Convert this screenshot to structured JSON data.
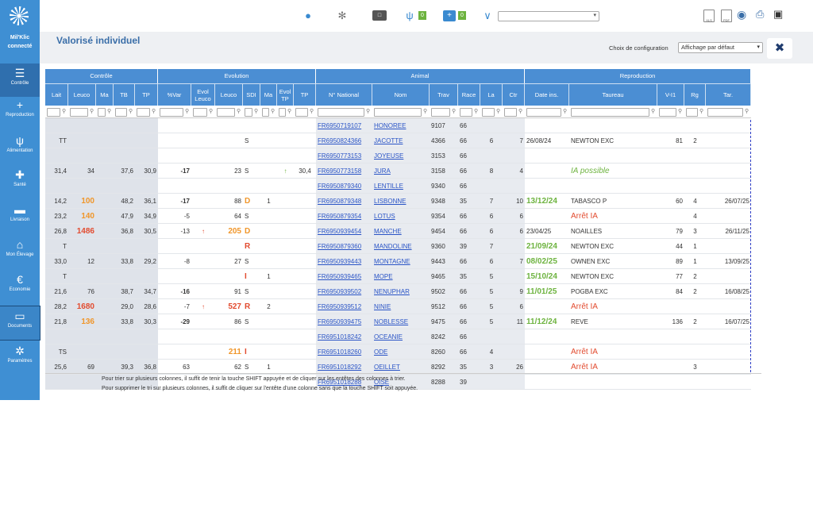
{
  "app": {
    "title": "Valorisé individuel",
    "brand_line1": "Mil'Klic",
    "brand_line2": "connecté"
  },
  "sidebar": {
    "items": [
      {
        "label": "Contrôle",
        "icon": "sliders-icon"
      },
      {
        "label": "Reproduction",
        "icon": "cow-plus-icon"
      },
      {
        "label": "Alimentation",
        "icon": "grass-icon"
      },
      {
        "label": "Santé",
        "icon": "medical-kit-icon"
      },
      {
        "label": "Livraison",
        "icon": "truck-icon"
      },
      {
        "label": "Mon Élevage",
        "icon": "home-icon"
      },
      {
        "label": "Economie",
        "icon": "euro-icon"
      },
      {
        "label": "Documents",
        "icon": "folder-icon"
      },
      {
        "label": "Paramètres",
        "icon": "gear-icon"
      }
    ]
  },
  "topbar": {
    "badge_alimentation": "0",
    "badge_sante": "0",
    "select_value": ""
  },
  "config": {
    "label": "Choix de configuration",
    "value": "Affichage par défaut"
  },
  "bands": {
    "controle": "Contrôle",
    "evolution": "Evolution",
    "animal": "Animal",
    "reproduction": "Reproduction"
  },
  "headers": [
    "Lait",
    "Leuco",
    "Ma",
    "TB",
    "TP",
    "%Var",
    "Evol Leuco",
    "Leuco",
    "SDI",
    "Ma",
    "Evol TP",
    "TP",
    "N° National",
    "Nom",
    "Trav",
    "Race",
    "La",
    "Ctr",
    "Date ins.",
    "Taureau",
    "V-I1",
    "Rg",
    "Tar."
  ],
  "rows": [
    {
      "lait": "",
      "leuco": "",
      "ma": "",
      "tb": "",
      "tp": "",
      "var": "",
      "evl": "",
      "eleuco": "",
      "sdi": "",
      "ema": "",
      "evtp": "",
      "etp": "",
      "nat": "FR6950719107",
      "nom": "HONOREE",
      "trav": "9107",
      "race": "66",
      "la": "",
      "ctr": "",
      "date": "",
      "taureau": "",
      "vi1": "",
      "rg": "",
      "tar": ""
    },
    {
      "lait": "TT",
      "leuco": "",
      "ma": "",
      "tb": "",
      "tp": "",
      "var": "",
      "evl": "",
      "eleuco": "",
      "sdi": "S",
      "ema": "",
      "evtp": "",
      "etp": "",
      "nat": "FR6950824366",
      "nom": "JACOTTE",
      "trav": "4366",
      "race": "66",
      "la": "6",
      "ctr": "7",
      "date": "26/08/24",
      "taureau": "NEWTON EXC",
      "vi1": "81",
      "rg": "2",
      "tar": ""
    },
    {
      "lait": "",
      "leuco": "",
      "ma": "",
      "tb": "",
      "tp": "",
      "var": "",
      "evl": "",
      "eleuco": "",
      "sdi": "",
      "ema": "",
      "evtp": "",
      "etp": "",
      "nat": "FR6950773153",
      "nom": "JOYEUSE",
      "trav": "3153",
      "race": "66",
      "la": "",
      "ctr": "",
      "date": "",
      "taureau": "",
      "vi1": "",
      "rg": "",
      "tar": ""
    },
    {
      "lait": "31,4",
      "leuco": "34",
      "ma": "",
      "tb": "37,6",
      "tp": "30,9",
      "var": "-17",
      "evl": "",
      "eleuco": "23",
      "sdi": "S",
      "ema": "",
      "evtp": "↑",
      "etp": "30,4",
      "nat": "FR6950773158",
      "nom": "JURA",
      "trav": "3158",
      "race": "66",
      "la": "8",
      "ctr": "4",
      "date": "",
      "taureau": "IA possible",
      "vi1": "",
      "rg": "",
      "tar": ""
    },
    {
      "lait": "",
      "leuco": "",
      "ma": "",
      "tb": "",
      "tp": "",
      "var": "",
      "evl": "",
      "eleuco": "",
      "sdi": "",
      "ema": "",
      "evtp": "",
      "etp": "",
      "nat": "FR6950879340",
      "nom": "LENTILLE",
      "trav": "9340",
      "race": "66",
      "la": "",
      "ctr": "",
      "date": "",
      "taureau": "",
      "vi1": "",
      "rg": "",
      "tar": ""
    },
    {
      "lait": "14,2",
      "leuco": "100",
      "ma": "",
      "tb": "48,2",
      "tp": "36,1",
      "var": "-17",
      "evl": "",
      "eleuco": "88",
      "sdi": "D",
      "ema": "1",
      "evtp": "",
      "etp": "",
      "nat": "FR6950879348",
      "nom": "LISBONNE",
      "trav": "9348",
      "race": "35",
      "la": "7",
      "ctr": "10",
      "date": "13/12/24",
      "taureau": "TABASCO P",
      "vi1": "60",
      "rg": "4",
      "tar": "26/07/25"
    },
    {
      "lait": "23,2",
      "leuco": "140",
      "ma": "",
      "tb": "47,9",
      "tp": "34,9",
      "var": "-5",
      "evl": "",
      "eleuco": "64",
      "sdi": "S",
      "ema": "",
      "evtp": "",
      "etp": "",
      "nat": "FR6950879354",
      "nom": "LOTUS",
      "trav": "9354",
      "race": "66",
      "la": "6",
      "ctr": "6",
      "date": "",
      "taureau": "Arrêt IA",
      "vi1": "",
      "rg": "4",
      "tar": ""
    },
    {
      "lait": "26,8",
      "leuco": "1486",
      "ma": "",
      "tb": "36,8",
      "tp": "30,5",
      "var": "-13",
      "evl": "↑",
      "eleuco": "205",
      "sdi": "D",
      "ema": "",
      "evtp": "",
      "etp": "",
      "nat": "FR6950939454",
      "nom": "MANCHE",
      "trav": "9454",
      "race": "66",
      "la": "6",
      "ctr": "6",
      "date": "23/04/25",
      "taureau": "NOAILLES",
      "vi1": "79",
      "rg": "3",
      "tar": "26/11/25"
    },
    {
      "lait": "T",
      "leuco": "",
      "ma": "",
      "tb": "",
      "tp": "",
      "var": "",
      "evl": "",
      "eleuco": "",
      "sdi": "R",
      "ema": "",
      "evtp": "",
      "etp": "",
      "nat": "FR6950879360",
      "nom": "MANDOLINE",
      "trav": "9360",
      "race": "39",
      "la": "7",
      "ctr": "",
      "date": "21/09/24",
      "taureau": "NEWTON EXC",
      "vi1": "44",
      "rg": "1",
      "tar": ""
    },
    {
      "lait": "33,0",
      "leuco": "12",
      "ma": "",
      "tb": "33,8",
      "tp": "29,2",
      "var": "-8",
      "evl": "",
      "eleuco": "27",
      "sdi": "S",
      "ema": "",
      "evtp": "",
      "etp": "",
      "nat": "FR6950939443",
      "nom": "MONTAGNE",
      "trav": "9443",
      "race": "66",
      "la": "6",
      "ctr": "7",
      "date": "08/02/25",
      "taureau": "OWNEN EXC",
      "vi1": "89",
      "rg": "1",
      "tar": "13/09/25"
    },
    {
      "lait": "T",
      "leuco": "",
      "ma": "",
      "tb": "",
      "tp": "",
      "var": "",
      "evl": "",
      "eleuco": "",
      "sdi": "I",
      "ema": "1",
      "evtp": "",
      "etp": "",
      "nat": "FR6950939465",
      "nom": "MOPE",
      "trav": "9465",
      "race": "35",
      "la": "5",
      "ctr": "",
      "date": "15/10/24",
      "taureau": "NEWTON EXC",
      "vi1": "77",
      "rg": "2",
      "tar": ""
    },
    {
      "lait": "21,6",
      "leuco": "76",
      "ma": "",
      "tb": "38,7",
      "tp": "34,7",
      "var": "-16",
      "evl": "",
      "eleuco": "91",
      "sdi": "S",
      "ema": "",
      "evtp": "",
      "etp": "",
      "nat": "FR6950939502",
      "nom": "NENUPHAR",
      "trav": "9502",
      "race": "66",
      "la": "5",
      "ctr": "9",
      "date": "11/01/25",
      "taureau": "POGBA EXC",
      "vi1": "84",
      "rg": "2",
      "tar": "16/08/25"
    },
    {
      "lait": "28,2",
      "leuco": "1680",
      "ma": "",
      "tb": "29,0",
      "tp": "28,6",
      "var": "-7",
      "evl": "↑",
      "eleuco": "527",
      "sdi": "R",
      "ema": "2",
      "evtp": "",
      "etp": "",
      "nat": "FR6950939512",
      "nom": "NINIE",
      "trav": "9512",
      "race": "66",
      "la": "5",
      "ctr": "6",
      "date": "",
      "taureau": "Arrêt IA",
      "vi1": "",
      "rg": "",
      "tar": ""
    },
    {
      "lait": "21,8",
      "leuco": "136",
      "ma": "",
      "tb": "33,8",
      "tp": "30,3",
      "var": "-29",
      "evl": "",
      "eleuco": "86",
      "sdi": "S",
      "ema": "",
      "evtp": "",
      "etp": "",
      "nat": "FR6950939475",
      "nom": "NOBLESSE",
      "trav": "9475",
      "race": "66",
      "la": "5",
      "ctr": "11",
      "date": "11/12/24",
      "taureau": "REVE",
      "vi1": "136",
      "rg": "2",
      "tar": "16/07/25"
    },
    {
      "lait": "",
      "leuco": "",
      "ma": "",
      "tb": "",
      "tp": "",
      "var": "",
      "evl": "",
      "eleuco": "",
      "sdi": "",
      "ema": "",
      "evtp": "",
      "etp": "",
      "nat": "FR6951018242",
      "nom": "OCEANIE",
      "trav": "8242",
      "race": "66",
      "la": "",
      "ctr": "",
      "date": "",
      "taureau": "",
      "vi1": "",
      "rg": "",
      "tar": ""
    },
    {
      "lait": "TS",
      "leuco": "",
      "ma": "",
      "tb": "",
      "tp": "",
      "var": "",
      "evl": "",
      "eleuco": "211",
      "sdi": "I",
      "ema": "",
      "evtp": "",
      "etp": "",
      "nat": "FR6951018260",
      "nom": "ODE",
      "trav": "8260",
      "race": "66",
      "la": "4",
      "ctr": "",
      "date": "",
      "taureau": "Arrêt IA",
      "vi1": "",
      "rg": "",
      "tar": ""
    },
    {
      "lait": "25,6",
      "leuco": "69",
      "ma": "",
      "tb": "39,3",
      "tp": "36,8",
      "var": "63",
      "evl": "",
      "eleuco": "62",
      "sdi": "S",
      "ema": "1",
      "evtp": "",
      "etp": "",
      "nat": "FR6951018292",
      "nom": "OEILLET",
      "trav": "8292",
      "race": "35",
      "la": "3",
      "ctr": "26",
      "date": "",
      "taureau": "Arrêt IA",
      "vi1": "",
      "rg": "3",
      "tar": ""
    },
    {
      "lait": "",
      "leuco": "",
      "ma": "",
      "tb": "",
      "tp": "",
      "var": "",
      "evl": "",
      "eleuco": "",
      "sdi": "",
      "ema": "",
      "evtp": "",
      "etp": "",
      "nat": "FR6951018288",
      "nom": "OISE",
      "trav": "8288",
      "race": "39",
      "la": "",
      "ctr": "",
      "date": "",
      "taureau": "",
      "vi1": "",
      "rg": "",
      "tar": ""
    }
  ],
  "styles": {
    "leuco": {
      "100": "orange",
      "140": "orange",
      "1486": "red",
      "1680": "red",
      "136": "orange"
    },
    "eleuco": {
      "205": "orange",
      "527": "red",
      "211": "orange"
    },
    "sdi": {
      "D": "orange",
      "R": "red",
      "I": "red"
    },
    "var_bold": true,
    "taureau_special": {
      "IA possible": "ia",
      "Arrêt IA": "arret"
    },
    "accent": "#4b8ed3"
  },
  "notes": [
    "Pour trier sur plusieurs colonnes, il suffit de tenir la touche SHIFT appuyée et de cliquer sur les entêtes des colonnes à trier.",
    "Pour supprimer le tri sur plusieurs colonnes, il suffit de cliquer sur l'entête d'une colonne sans que la touche SHIFT soit appuyée."
  ]
}
